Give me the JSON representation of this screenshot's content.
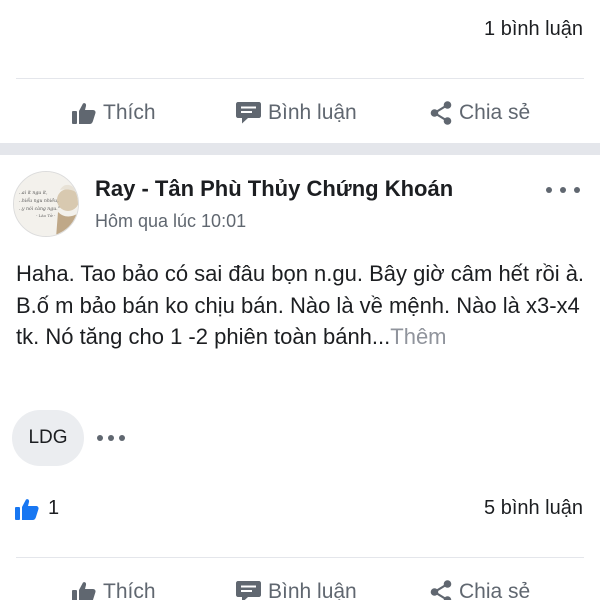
{
  "previous_post": {
    "comments_count": "1 bình luận"
  },
  "actions": {
    "like": "Thích",
    "comment": "Bình luận",
    "share": "Chia sẻ"
  },
  "post": {
    "author": "Ray - Tân Phù Thủy Chứng Khoán",
    "time": "Hôm qua lúc 10:01",
    "text": "Haha. Tao bảo có sai đâu bọn n.gu. Bây giờ câm hết rồi à. B.ố m bảo bán ko chịu bán. Nào là về mệnh. Nào là x3-x4 tk. Nó tăng cho 1 -2 phiên toàn bánh...",
    "see_more": "Thêm",
    "tag": "LDG",
    "likes": "1",
    "comments_count": "5 bình luận",
    "avatar_quote": [
      "..ai ít ngu ít,",
      "..hiểu ngu nhiều,",
      "..y nói càng ngu.\"",
      "- Lão Tử -"
    ]
  },
  "colors": {
    "text": "#1c1e21",
    "secondary": "#606770",
    "divider": "#e4e6eb",
    "like_blue": "#1877f2",
    "see_more": "#90949c"
  },
  "icons": [
    "thumbs-up-icon",
    "comment-icon",
    "share-icon",
    "more-icon"
  ]
}
